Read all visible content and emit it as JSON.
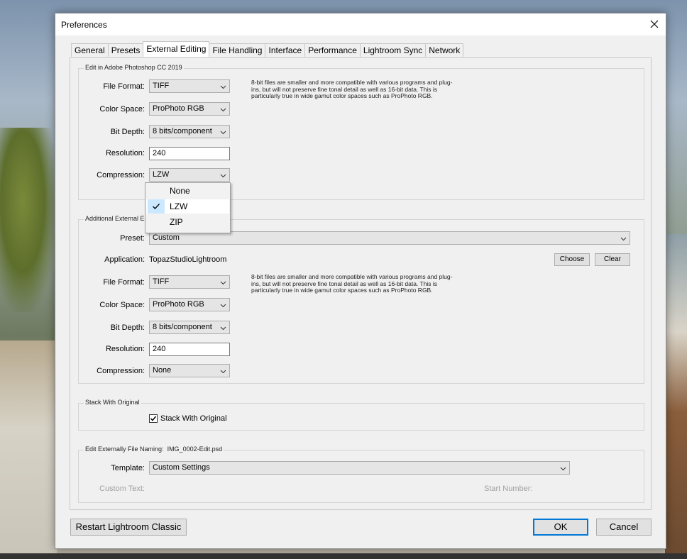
{
  "window": {
    "title": "Preferences"
  },
  "tabs": [
    "General",
    "Presets",
    "External Editing",
    "File Handling",
    "Interface",
    "Performance",
    "Lightroom Sync",
    "Network"
  ],
  "active_tab": "External Editing",
  "photoshop": {
    "group_label": "Edit in Adobe Photoshop CC 2019",
    "file_format_label": "File Format:",
    "file_format": "TIFF",
    "color_space_label": "Color Space:",
    "color_space": "ProPhoto RGB",
    "bit_depth_label": "Bit Depth:",
    "bit_depth": "8 bits/component",
    "resolution_label": "Resolution:",
    "resolution": "240",
    "compression_label": "Compression:",
    "compression": "LZW",
    "note": "8-bit files are smaller and more compatible with various programs and plug-ins, but will not preserve fine tonal detail as well as 16-bit data. This is particularly true in wide gamut color spaces such as ProPhoto RGB."
  },
  "compression_menu": {
    "options": [
      "None",
      "LZW",
      "ZIP"
    ],
    "checked": "LZW"
  },
  "additional": {
    "group_label": "Additional External E",
    "preset_label": "Preset:",
    "preset": "Custom",
    "application_label": "Application:",
    "application": "TopazStudioLightroom",
    "choose_label": "Choose",
    "clear_label": "Clear",
    "file_format_label": "File Format:",
    "file_format": "TIFF",
    "color_space_label": "Color Space:",
    "color_space": "ProPhoto RGB",
    "bit_depth_label": "Bit Depth:",
    "bit_depth": "8 bits/component",
    "resolution_label": "Resolution:",
    "resolution": "240",
    "compression_label": "Compression:",
    "compression": "None",
    "note": "8-bit files are smaller and more compatible with various programs and plug-ins, but will not preserve fine tonal detail as well as 16-bit data. This is particularly true in wide gamut color spaces such as ProPhoto RGB."
  },
  "stack": {
    "group_label": "Stack With Original",
    "checkbox_label": "Stack With Original",
    "checked": true
  },
  "naming": {
    "group_label": "Edit Externally File Naming:",
    "example": "IMG_0002-Edit.psd",
    "template_label": "Template:",
    "template": "Custom Settings",
    "custom_text_label": "Custom Text:",
    "start_number_label": "Start Number:"
  },
  "footer": {
    "restart_label": "Restart Lightroom Classic",
    "ok_label": "OK",
    "cancel_label": "Cancel"
  },
  "colors": {
    "accent": "#0078d7",
    "menu_check_bg": "#cce8ff"
  },
  "icons": {
    "close": "close-icon",
    "dropdown": "chevron-down-icon",
    "check": "checkmark-icon"
  }
}
